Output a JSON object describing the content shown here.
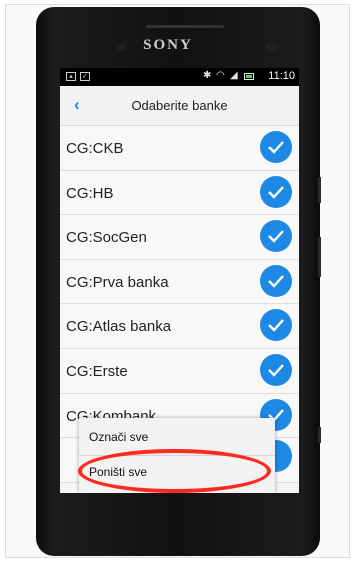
{
  "device": {
    "brand": "SONY"
  },
  "statusbar": {
    "time": "11:10"
  },
  "header": {
    "back_glyph": "‹",
    "title": "Odaberite banke"
  },
  "banks": [
    {
      "label": "CG:CKB",
      "checked": true
    },
    {
      "label": "CG:HB",
      "checked": true
    },
    {
      "label": "CG:SocGen",
      "checked": true
    },
    {
      "label": "CG:Prva banka",
      "checked": true
    },
    {
      "label": "CG:Atlas banka",
      "checked": true
    },
    {
      "label": "CG:Erste",
      "checked": true
    },
    {
      "label": "CG:Kombank",
      "checked": true
    }
  ],
  "menu": {
    "items": [
      {
        "label": "Označi sve"
      },
      {
        "label": "Poništi sve"
      }
    ]
  },
  "colors": {
    "accent": "#1e88e5",
    "highlight": "#ff2a1f"
  }
}
